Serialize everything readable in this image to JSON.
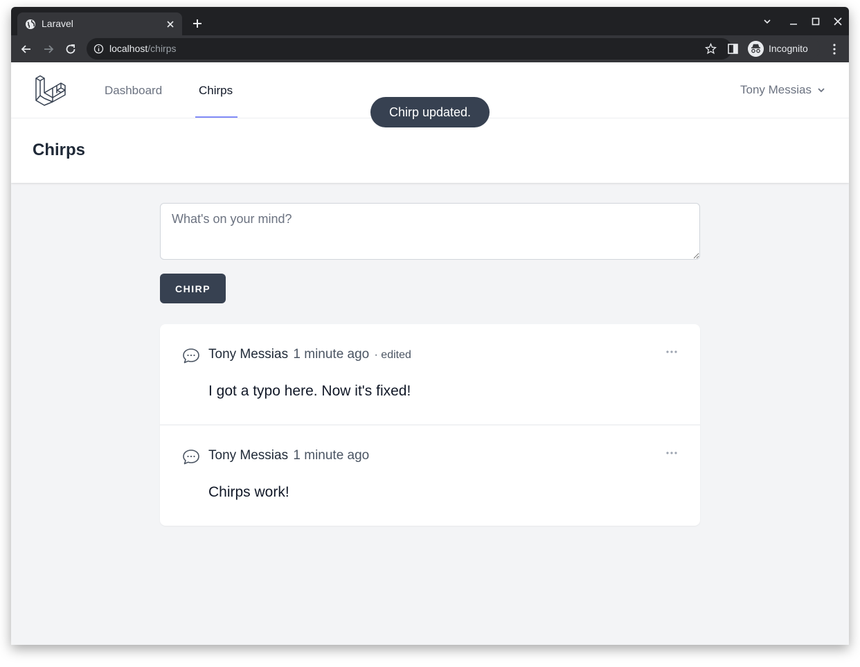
{
  "browser": {
    "tab_title": "Laravel",
    "url_host": "localhost",
    "url_path": "/chirps",
    "incognito_label": "Incognito"
  },
  "nav": {
    "links": [
      {
        "label": "Dashboard",
        "active": false
      },
      {
        "label": "Chirps",
        "active": true
      }
    ],
    "user_name": "Tony Messias"
  },
  "toast": "Chirp updated.",
  "header": {
    "title": "Chirps"
  },
  "composer": {
    "placeholder": "What's on your mind?",
    "value": "",
    "button_label": "CHIRP"
  },
  "chirps": [
    {
      "author": "Tony Messias",
      "time": "1 minute ago",
      "edited": "· edited",
      "message": "I got a typo here. Now it's fixed!"
    },
    {
      "author": "Tony Messias",
      "time": "1 minute ago",
      "edited": "",
      "message": "Chirps work!"
    }
  ],
  "colors": {
    "accent_underline": "#818cf8",
    "button": "#374151",
    "page_bg": "#f3f4f6"
  }
}
